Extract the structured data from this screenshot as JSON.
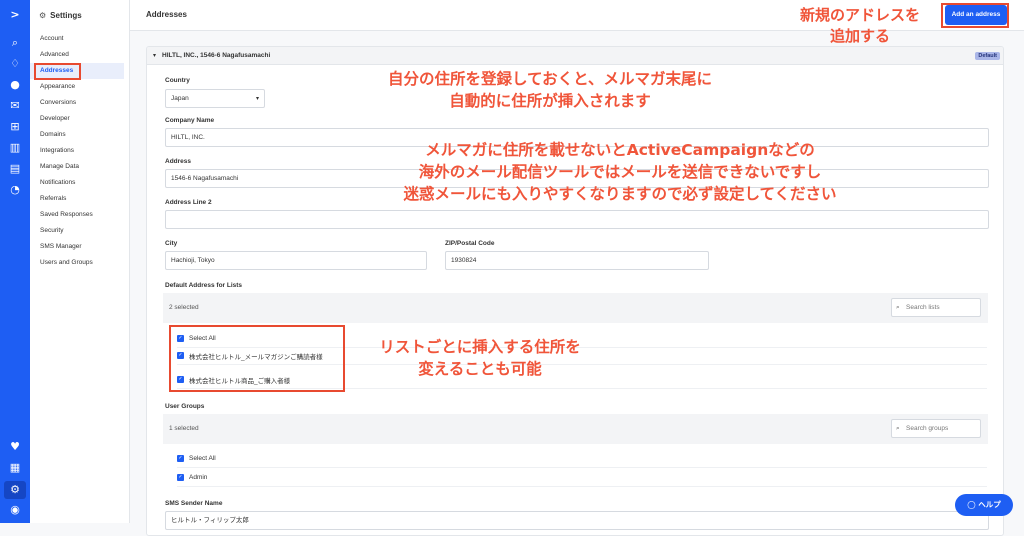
{
  "rail": {
    "icons": [
      "logo-chevron-icon",
      "search-icon",
      "lightbulb-icon",
      "user-icon",
      "mail-icon",
      "automation-icon",
      "pipeline-icon",
      "reports-icon",
      "pie-chart-icon",
      "heart-icon",
      "apps-icon",
      "settings-icon",
      "avatar-icon"
    ]
  },
  "sidebar": {
    "title": "Settings",
    "items": [
      {
        "label": "Account"
      },
      {
        "label": "Advanced"
      },
      {
        "label": "Addresses"
      },
      {
        "label": "Appearance"
      },
      {
        "label": "Conversions"
      },
      {
        "label": "Developer"
      },
      {
        "label": "Domains"
      },
      {
        "label": "Integrations"
      },
      {
        "label": "Manage Data"
      },
      {
        "label": "Notifications"
      },
      {
        "label": "Referrals"
      },
      {
        "label": "Saved Responses"
      },
      {
        "label": "Security"
      },
      {
        "label": "SMS Manager"
      },
      {
        "label": "Users and Groups"
      }
    ]
  },
  "header": {
    "title": "Addresses",
    "add_button": "Add an address"
  },
  "address": {
    "heading": "HILTL, INC., 1546-6 Nagafusamachi",
    "badge": "Default",
    "country_label": "Country",
    "country_value": "Japan",
    "company_label": "Company Name",
    "company_value": "HILTL, INC.",
    "address_label": "Address",
    "address_value": "1546-6 Nagafusamachi",
    "address2_label": "Address Line 2",
    "address2_value": "",
    "city_label": "City",
    "city_value": "Hachioji, Tokyo",
    "zip_label": "ZIP/Postal Code",
    "zip_value": "1930824",
    "lists_label": "Default Address for Lists",
    "lists_count": "2 selected",
    "lists_search_placeholder": "Search lists",
    "lists": [
      {
        "label": "Select All"
      },
      {
        "label": "株式会社ヒルトル_メールマガジンご購読者様"
      },
      {
        "label": "株式会社ヒルトル商品_ご購入者様"
      }
    ],
    "groups_label": "User Groups",
    "groups_count": "1 selected",
    "groups_search_placeholder": "Search groups",
    "groups": [
      {
        "label": "Select All"
      },
      {
        "label": "Admin"
      }
    ],
    "sms_label": "SMS Sender Name",
    "sms_value": "ヒルトル・フィリップ太郎"
  },
  "annotations": {
    "add_line1": "新規のアドレスを",
    "add_line2": "追加する",
    "footer_line1": "自分の住所を登録しておくと、メルマガ末尾に",
    "footer_line2": "自動的に住所が挿入されます",
    "warn_line1": "メルマガに住所を載せないとActiveCampaignなどの",
    "warn_line2": "海外のメール配信ツールではメールを送信できないですし",
    "warn_line3": "迷惑メールにも入りやすくなりますので必ず設定してください",
    "list_line1": "リストごとに挿入する住所を",
    "list_line2": "変えることも可能"
  },
  "help": {
    "label": "ヘルプ"
  },
  "colors": {
    "brand": "#1e5ef3",
    "annotation": "#f0553a"
  }
}
